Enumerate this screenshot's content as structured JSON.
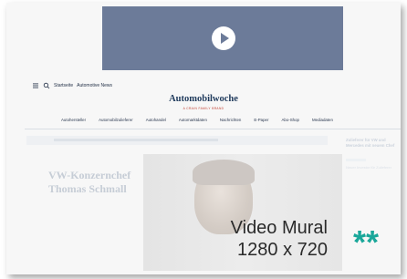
{
  "nav": {
    "menu_icon": "hamburger-icon",
    "search_icon": "search-icon",
    "home_label": "Startseite",
    "section_label": "Automotive News"
  },
  "site": {
    "logo_text": "Automobilwoche",
    "tagline": "A CRAIN FAMILY BRAND"
  },
  "menu": {
    "items": [
      "Autohersteller",
      "Automobilzulieferer",
      "Autohandel",
      "Automarktdaten",
      "Nachrichten",
      "E-Paper",
      "Abo-Shop",
      "Mediadaten"
    ]
  },
  "article": {
    "headline": "VW-Konzernchef Thomas Schmall"
  },
  "sidebar": {
    "heading": "Zulieferer für VW und Mercedes mit neuem Chef",
    "teaser": "Neuer Investor für Zulieferer"
  },
  "video": {
    "play_icon": "play-icon"
  },
  "overlay": {
    "title": "Video Mural",
    "size": "1280 x 720",
    "marker": "**",
    "marker_color": "#1aa79a"
  }
}
